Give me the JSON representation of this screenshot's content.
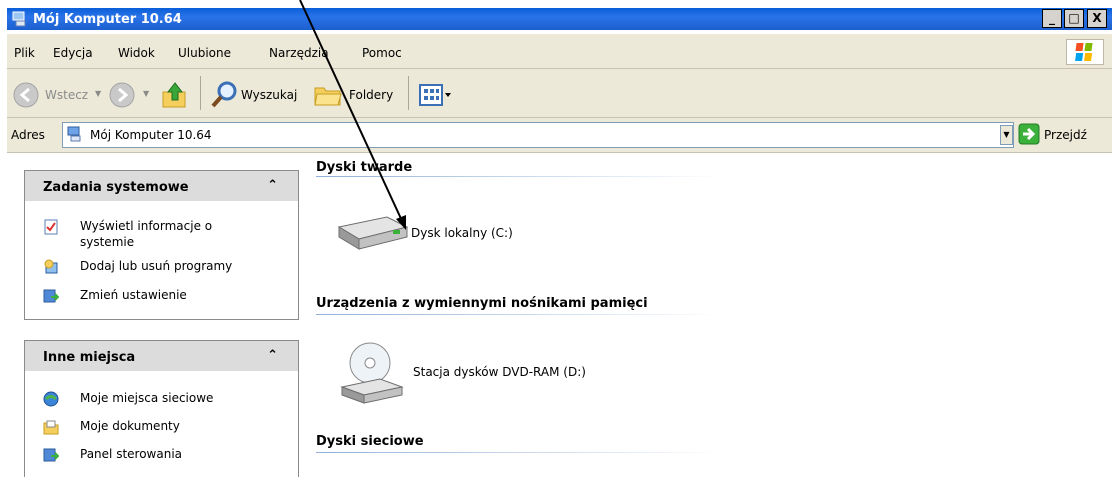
{
  "window": {
    "title": "Mój Komputer 10.64",
    "buttons": {
      "minimize": "_",
      "maximize": "□",
      "close": "X"
    }
  },
  "menu": [
    "Plik",
    "Edycja",
    "Widok",
    "Ulubione",
    "Narzędzia",
    "Pomoc"
  ],
  "toolbar": {
    "back": "Wstecz",
    "search": "Wyszukaj",
    "folders": "Foldery"
  },
  "address": {
    "label": "Adres",
    "value": "Mój Komputer 10.64",
    "go": "Przejdź"
  },
  "sidebar": {
    "system_tasks": {
      "title": "Zadania systemowe",
      "items": [
        {
          "label_line1": "Wyświetl informacje o",
          "label_line2": "systemie"
        },
        {
          "label": "Dodaj lub usuń programy"
        },
        {
          "label": "Zmień ustawienie"
        }
      ]
    },
    "other_places": {
      "title": "Inne miejsca",
      "items": [
        {
          "label": "Moje miejsca sieciowe"
        },
        {
          "label": "Moje dokumenty"
        },
        {
          "label": "Panel sterowania"
        }
      ]
    }
  },
  "groups": {
    "hard_disks": {
      "title": "Dyski twarde",
      "items": [
        {
          "label": "Dysk lokalny (C:)"
        }
      ]
    },
    "removable": {
      "title": "Urządzenia z wymiennymi nośnikami pamięci",
      "items": [
        {
          "label": "Stacja dysków DVD-RAM (D:)"
        }
      ]
    },
    "network": {
      "title": "Dyski sieciowe"
    }
  },
  "colors": {
    "title_bar": "#1c5fcf",
    "chrome": "#ece9d8",
    "panel_head": "#dcdcdc",
    "go_green": "#3bb03b"
  }
}
